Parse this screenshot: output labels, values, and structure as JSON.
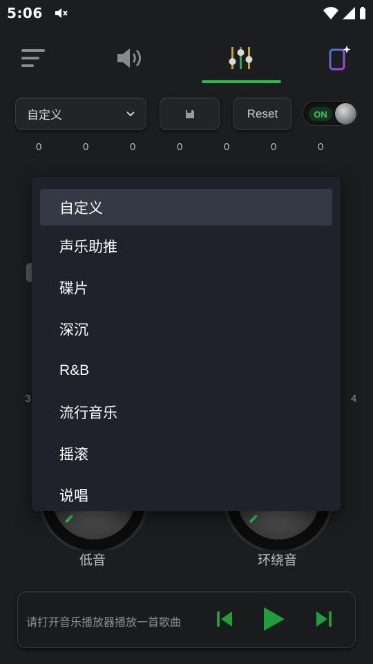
{
  "status": {
    "time": "5:06"
  },
  "preset": {
    "current": "自定义"
  },
  "reset_label": "Reset",
  "toggle_label": "ON",
  "eq_values": [
    "0",
    "0",
    "0",
    "0",
    "0",
    "0",
    "0"
  ],
  "bg_labels": {
    "left": "3",
    "right": "4"
  },
  "knobs": {
    "bass": "低音",
    "surround": "环绕音"
  },
  "player": {
    "hint": "请打开音乐播放器播放一首歌曲"
  },
  "colors": {
    "accent": "#2fb84a",
    "menu_bg": "#1f222b",
    "menu_selected": "#353845"
  },
  "icons": {
    "nav_menu": "list-menu-icon",
    "nav_volume": "speaker-icon",
    "nav_equalizer": "equalizer-sliders-icon",
    "nav_device": "phone-sparkle-icon",
    "save": "floppy-disk-icon",
    "dropdown_arrow": "chevron-down-icon",
    "prev": "skip-previous-icon",
    "play": "play-icon",
    "next": "skip-next-icon"
  },
  "dropdown": {
    "items": [
      "自定义",
      "声乐助推",
      "碟片",
      "深沉",
      "R&B",
      "流行音乐",
      "摇滚",
      "说唱"
    ]
  }
}
